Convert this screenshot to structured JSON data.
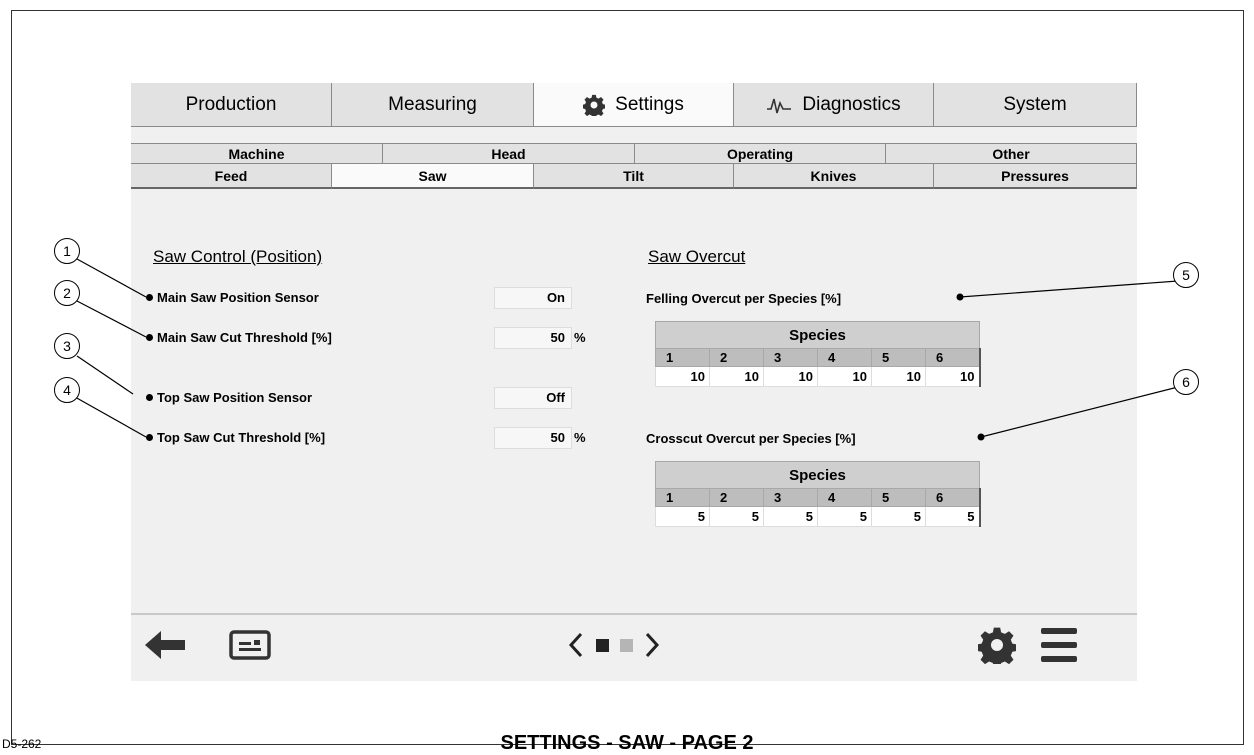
{
  "tabs_main": [
    {
      "label": "Production",
      "icon": null,
      "active": false
    },
    {
      "label": "Measuring",
      "icon": null,
      "active": false
    },
    {
      "label": "Settings",
      "icon": "gear-icon",
      "active": true
    },
    {
      "label": "Diagnostics",
      "icon": "pulse-icon",
      "active": false
    },
    {
      "label": "System",
      "icon": null,
      "active": false
    }
  ],
  "tabs_sub": [
    "Machine",
    "Head",
    "Operating",
    "Other"
  ],
  "tabs_page": [
    {
      "label": "Feed",
      "active": false
    },
    {
      "label": "Saw",
      "active": true
    },
    {
      "label": "Tilt",
      "active": false
    },
    {
      "label": "Knives",
      "active": false
    },
    {
      "label": "Pressures",
      "active": false
    }
  ],
  "saw_control": {
    "title": "Saw Control (Position)",
    "main_sensor": {
      "label": "Main Saw Position Sensor",
      "value": "On"
    },
    "main_threshold": {
      "label": "Main Saw Cut Threshold [%]",
      "value": "50",
      "unit": "%"
    },
    "top_sensor": {
      "label": "Top Saw Position Sensor",
      "value": "Off"
    },
    "top_threshold": {
      "label": "Top Saw Cut Threshold [%]",
      "value": "50",
      "unit": "%"
    }
  },
  "saw_overcut": {
    "title": "Saw Overcut",
    "felling": {
      "label": "Felling Overcut per Species [%]",
      "header": "Species",
      "species": [
        "1",
        "2",
        "3",
        "4",
        "5",
        "6"
      ],
      "values": [
        "10",
        "10",
        "10",
        "10",
        "10",
        "10"
      ]
    },
    "crosscut": {
      "label": "Crosscut Overcut per Species [%]",
      "header": "Species",
      "species": [
        "1",
        "2",
        "3",
        "4",
        "5",
        "6"
      ],
      "values": [
        "5",
        "5",
        "5",
        "5",
        "5",
        "5"
      ]
    }
  },
  "pager": {
    "pages": 2,
    "current": 1
  },
  "callouts": [
    "1",
    "2",
    "3",
    "4",
    "5",
    "6"
  ],
  "caption": "SETTINGS - SAW - PAGE 2",
  "figure_id": "D5-262"
}
